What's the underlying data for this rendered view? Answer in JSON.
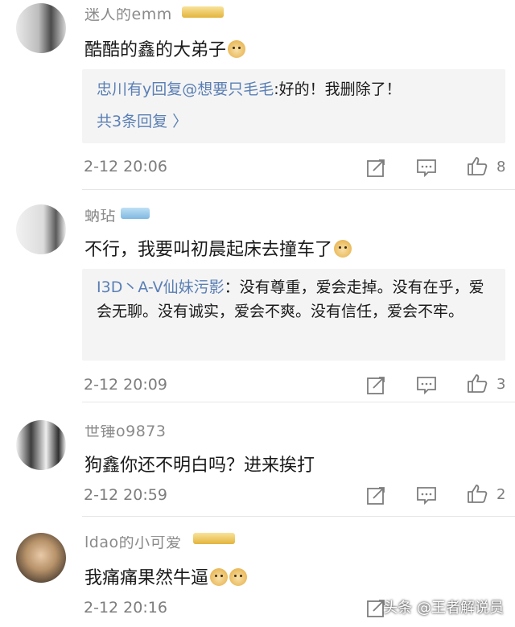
{
  "comments": [
    {
      "username": "迷人的emm",
      "text": "酷酷的鑫的大弟子",
      "emoji_icon": "doge-emoji",
      "reply": {
        "name": "忠川有y回复@想要只毛毛",
        "content": ":好的！我删除了！",
        "more": "共3条回复 〉"
      },
      "time": "2-12 20:06",
      "likes": "8"
    },
    {
      "username": "蚋玷",
      "text": "不行，我要叫初晨起床去撞车了",
      "emoji_icon": "doge-emoji",
      "reply": {
        "name": "I3D丶A-V仙妹污影",
        "content": "：没有尊重，爱会走掉。没有在乎，爱会无聊。没有诚实，爱会不爽。没有信任，爱会不牢。",
        "more": ""
      },
      "time": "2-12 20:09",
      "likes": "3"
    },
    {
      "username": "世锤o9873",
      "text": "狗鑫你还不明白吗？进来挨打",
      "emoji_icon": "",
      "reply": null,
      "time": "2-12 20:59",
      "likes": "2"
    },
    {
      "username": "ldao的小可爱",
      "text": "我痛痛果然牛逼",
      "emoji_icon": "doge-emoji",
      "reply": null,
      "time": "2-12 20:16",
      "likes": ""
    }
  ],
  "watermark": "头条 @王者解说员",
  "colors": {
    "link": "#5a7fb5",
    "meta": "#7d7d7d",
    "reply_bg": "#f4f4f4"
  },
  "icons": {
    "repost": "repost-icon",
    "comment": "comment-icon",
    "like": "thumbs-up-icon"
  }
}
